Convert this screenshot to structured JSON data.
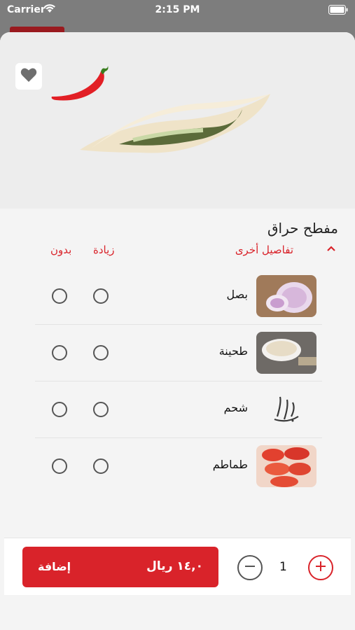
{
  "status_bar": {
    "carrier": "Carrier",
    "time": "2:15 PM"
  },
  "product": {
    "title": "مفطح حراق",
    "image_icon": "sandwich-image",
    "badge_icon": "chili-pepper-icon"
  },
  "options_header": {
    "details_label": "تفاصيل أخرى",
    "extra_label": "زيادة",
    "without_label": "بدون"
  },
  "options": [
    {
      "label": "بصل",
      "thumb": "onion-image"
    },
    {
      "label": "طحينة",
      "thumb": "tahini-image"
    },
    {
      "label": "شحم",
      "thumb": "brand-logo-image"
    },
    {
      "label": "طماطم",
      "thumb": "tomato-image"
    }
  ],
  "footer": {
    "add_label": "إضافة",
    "price_label": "١٤,٠ ريال",
    "quantity": "1"
  },
  "colors": {
    "accent": "#d9232a",
    "background": "#f4f4f4"
  }
}
